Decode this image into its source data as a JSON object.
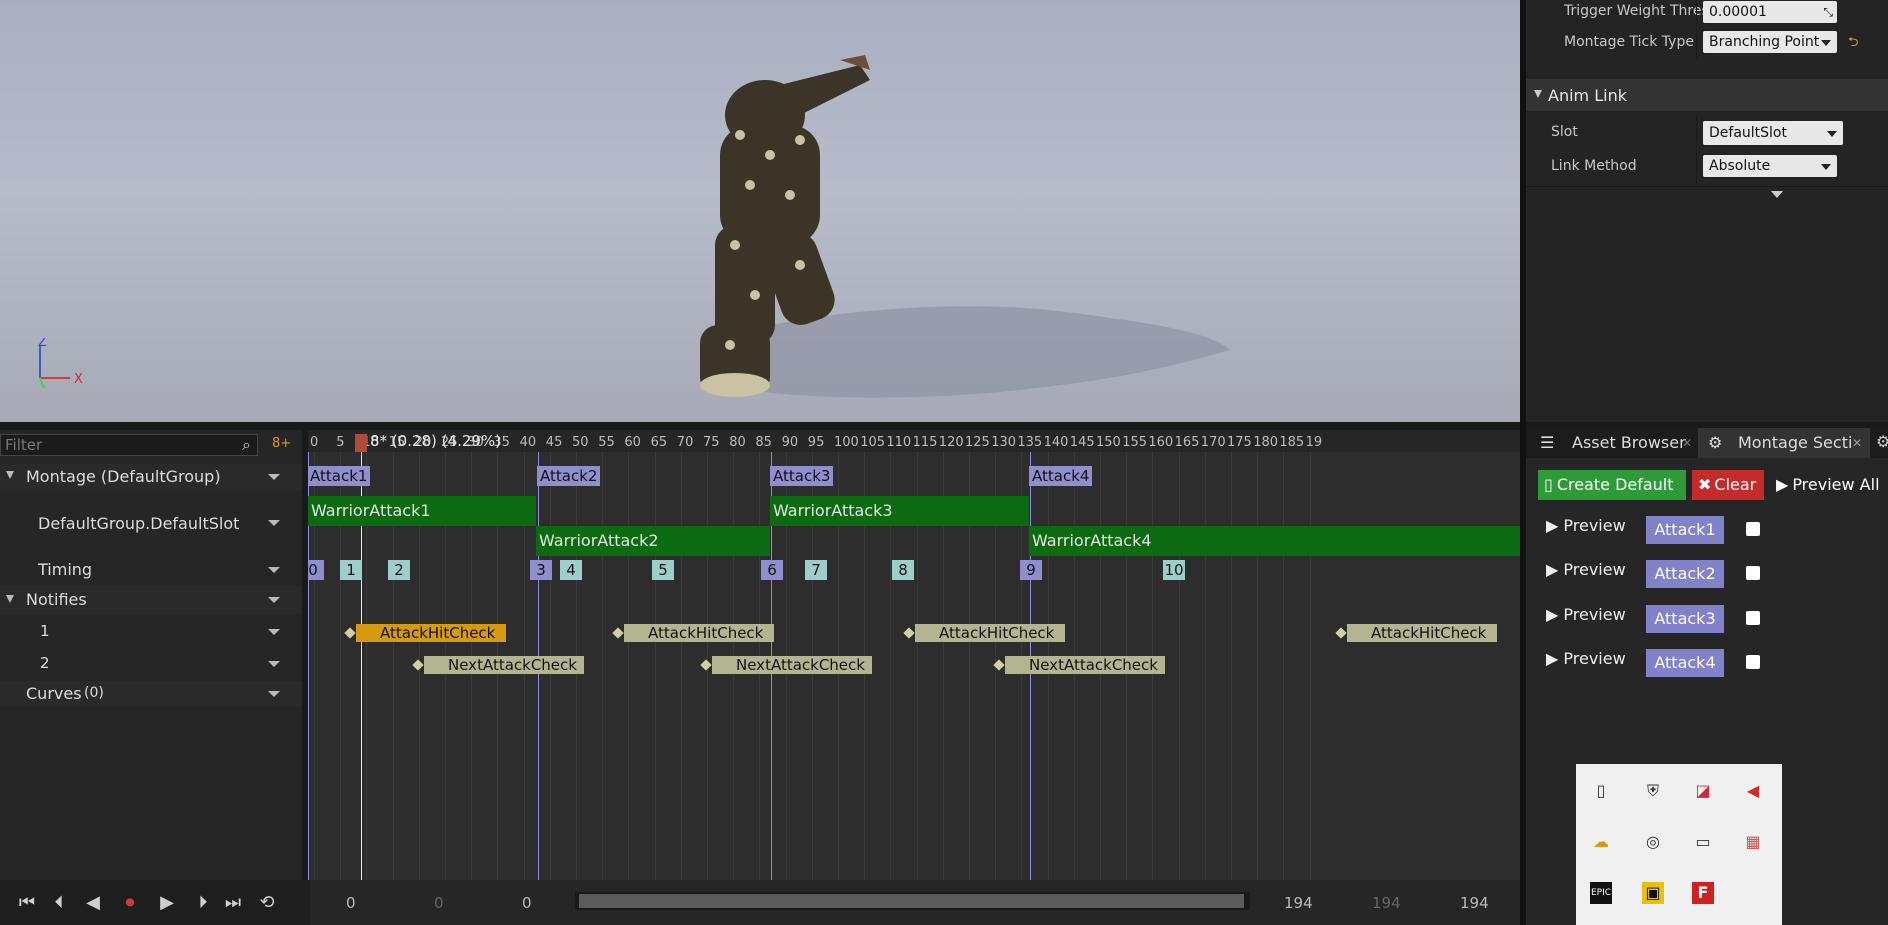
{
  "viewport": {
    "axis_x": "X",
    "axis_z": "Z"
  },
  "details": {
    "trigger_weight_label": "Trigger Weight Thresh",
    "trigger_weight_value": "0.00001",
    "montage_tick_label": "Montage Tick Type",
    "montage_tick_value": "Branching Point",
    "anim_link_header": "Anim Link",
    "slot_label": "Slot",
    "slot_value": "DefaultSlot",
    "link_method_label": "Link Method",
    "link_method_value": "Absolute"
  },
  "tracks": {
    "filter_placeholder": "Filter",
    "filter_badge": "8+",
    "montage_group": "Montage (DefaultGroup)",
    "slot_name": "DefaultGroup.DefaultSlot",
    "timing": "Timing",
    "notifies": "Notifies",
    "notify_track_1": "1",
    "notify_track_2": "2",
    "curves": "Curves",
    "curves_count": "(0)"
  },
  "timeline": {
    "scrubber_label": "8* (0.28) (4.29%)",
    "ticks": [
      "0",
      "5",
      "10",
      "15",
      "20",
      "25",
      "30",
      "35",
      "40",
      "45",
      "50",
      "55",
      "60",
      "65",
      "70",
      "75",
      "80",
      "85",
      "90",
      "95",
      "100",
      "105",
      "110",
      "115",
      "120",
      "125",
      "130",
      "135",
      "140",
      "145",
      "150",
      "155",
      "160",
      "165",
      "170",
      "175",
      "180",
      "185",
      "19"
    ],
    "sections": [
      "Attack1",
      "Attack2",
      "Attack3",
      "Attack4"
    ],
    "segments": [
      "WarriorAttack1",
      "WarriorAttack2",
      "WarriorAttack3",
      "WarriorAttack4"
    ],
    "timing_markers": [
      "0",
      "1",
      "2",
      "3",
      "4",
      "5",
      "6",
      "7",
      "8",
      "9",
      "10"
    ],
    "notifies_row1": [
      "AttackHitCheck",
      "AttackHitCheck",
      "AttackHitCheck",
      "AttackHitCheck"
    ],
    "notifies_row2": [
      "NextAttackCheck",
      "NextAttackCheck",
      "NextAttackCheck"
    ]
  },
  "transport": {
    "start_a": "0",
    "start_b": "0",
    "start_c": "0",
    "end_a": "194",
    "end_b": "194",
    "end_c": "194"
  },
  "montage_panel": {
    "tab_asset_browser": "Asset Browser",
    "tab_montage_sections": "Montage Secti",
    "create_default": "Create Default",
    "clear": "Clear",
    "preview_all": "Preview All",
    "preview_label": "Preview",
    "sections": [
      "Attack1",
      "Attack2",
      "Attack3",
      "Attack4"
    ]
  },
  "colors": {
    "section": "#8f8fd0",
    "segment": "#0c6a10",
    "notify": "#b4b490",
    "notify_selected": "#d69a10",
    "create_default": "#2f9a3a",
    "clear": "#c42b2b"
  }
}
